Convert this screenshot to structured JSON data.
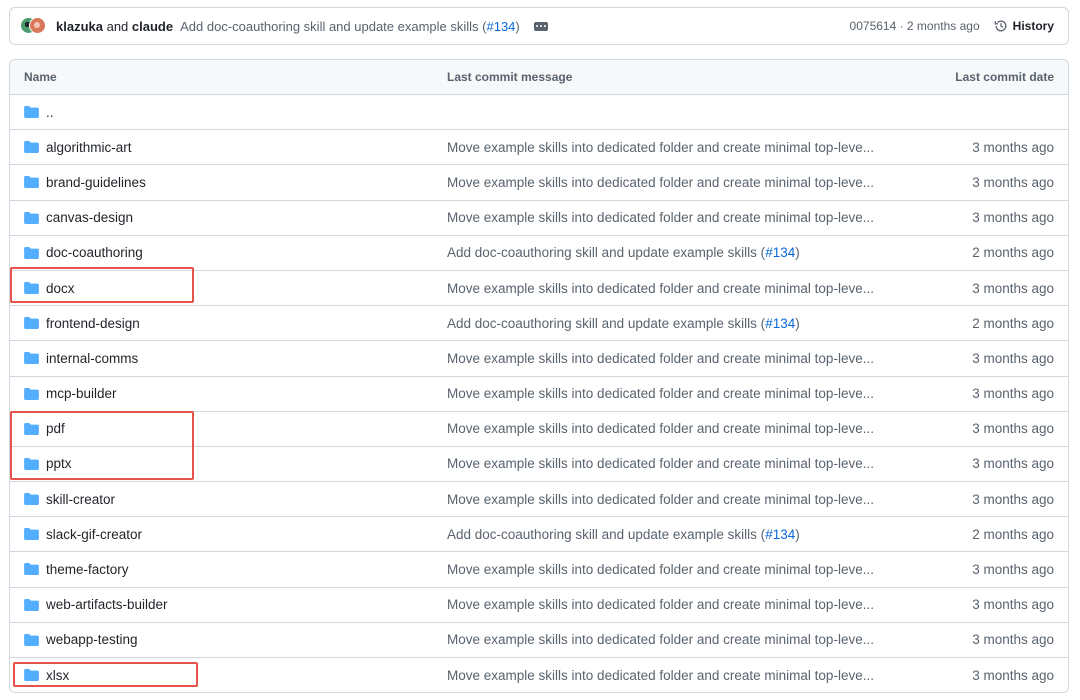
{
  "commit": {
    "author1": "klazuka",
    "and": " and ",
    "author2": "claude",
    "message": "Add doc-coauthoring skill and update example skills (",
    "pr": "#134",
    "message_end": ")",
    "hash_date": "0075614 · 2 months ago",
    "history_label": "History"
  },
  "table": {
    "headers": {
      "name": "Name",
      "message": "Last commit message",
      "date": "Last commit date"
    },
    "rows": [
      {
        "name": "..",
        "message": "",
        "date": ""
      },
      {
        "name": "algorithmic-art",
        "message": "Move example skills into dedicated folder and create minimal top-leve...",
        "date": "3 months ago"
      },
      {
        "name": "brand-guidelines",
        "message": "Move example skills into dedicated folder and create minimal top-leve...",
        "date": "3 months ago"
      },
      {
        "name": "canvas-design",
        "message": "Move example skills into dedicated folder and create minimal top-leve...",
        "date": "3 months ago"
      },
      {
        "name": "doc-coauthoring",
        "message": "Add doc-coauthoring skill and update example skills (",
        "pr": "#134",
        "message_end": ")",
        "date": "2 months ago"
      },
      {
        "name": "docx",
        "message": "Move example skills into dedicated folder and create minimal top-leve...",
        "date": "3 months ago"
      },
      {
        "name": "frontend-design",
        "message": "Add doc-coauthoring skill and update example skills (",
        "pr": "#134",
        "message_end": ")",
        "date": "2 months ago"
      },
      {
        "name": "internal-comms",
        "message": "Move example skills into dedicated folder and create minimal top-leve...",
        "date": "3 months ago"
      },
      {
        "name": "mcp-builder",
        "message": "Move example skills into dedicated folder and create minimal top-leve...",
        "date": "3 months ago"
      },
      {
        "name": "pdf",
        "message": "Move example skills into dedicated folder and create minimal top-leve...",
        "date": "3 months ago"
      },
      {
        "name": "pptx",
        "message": "Move example skills into dedicated folder and create minimal top-leve...",
        "date": "3 months ago"
      },
      {
        "name": "skill-creator",
        "message": "Move example skills into dedicated folder and create minimal top-leve...",
        "date": "3 months ago"
      },
      {
        "name": "slack-gif-creator",
        "message": "Add doc-coauthoring skill and update example skills (",
        "pr": "#134",
        "message_end": ")",
        "date": "2 months ago"
      },
      {
        "name": "theme-factory",
        "message": "Move example skills into dedicated folder and create minimal top-leve...",
        "date": "3 months ago"
      },
      {
        "name": "web-artifacts-builder",
        "message": "Move example skills into dedicated folder and create minimal top-leve...",
        "date": "3 months ago"
      },
      {
        "name": "webapp-testing",
        "message": "Move example skills into dedicated folder and create minimal top-leve...",
        "date": "3 months ago"
      },
      {
        "name": "xlsx",
        "message": "Move example skills into dedicated folder and create minimal top-leve...",
        "date": "3 months ago"
      }
    ]
  },
  "colors": {
    "folder": "#54aeff",
    "link": "#0969da",
    "highlight": "#e5534b",
    "border": "#d0d7de"
  },
  "icons": {
    "folder": "folder-icon",
    "history": "history-icon",
    "ellipsis": "ellipsis-icon"
  }
}
